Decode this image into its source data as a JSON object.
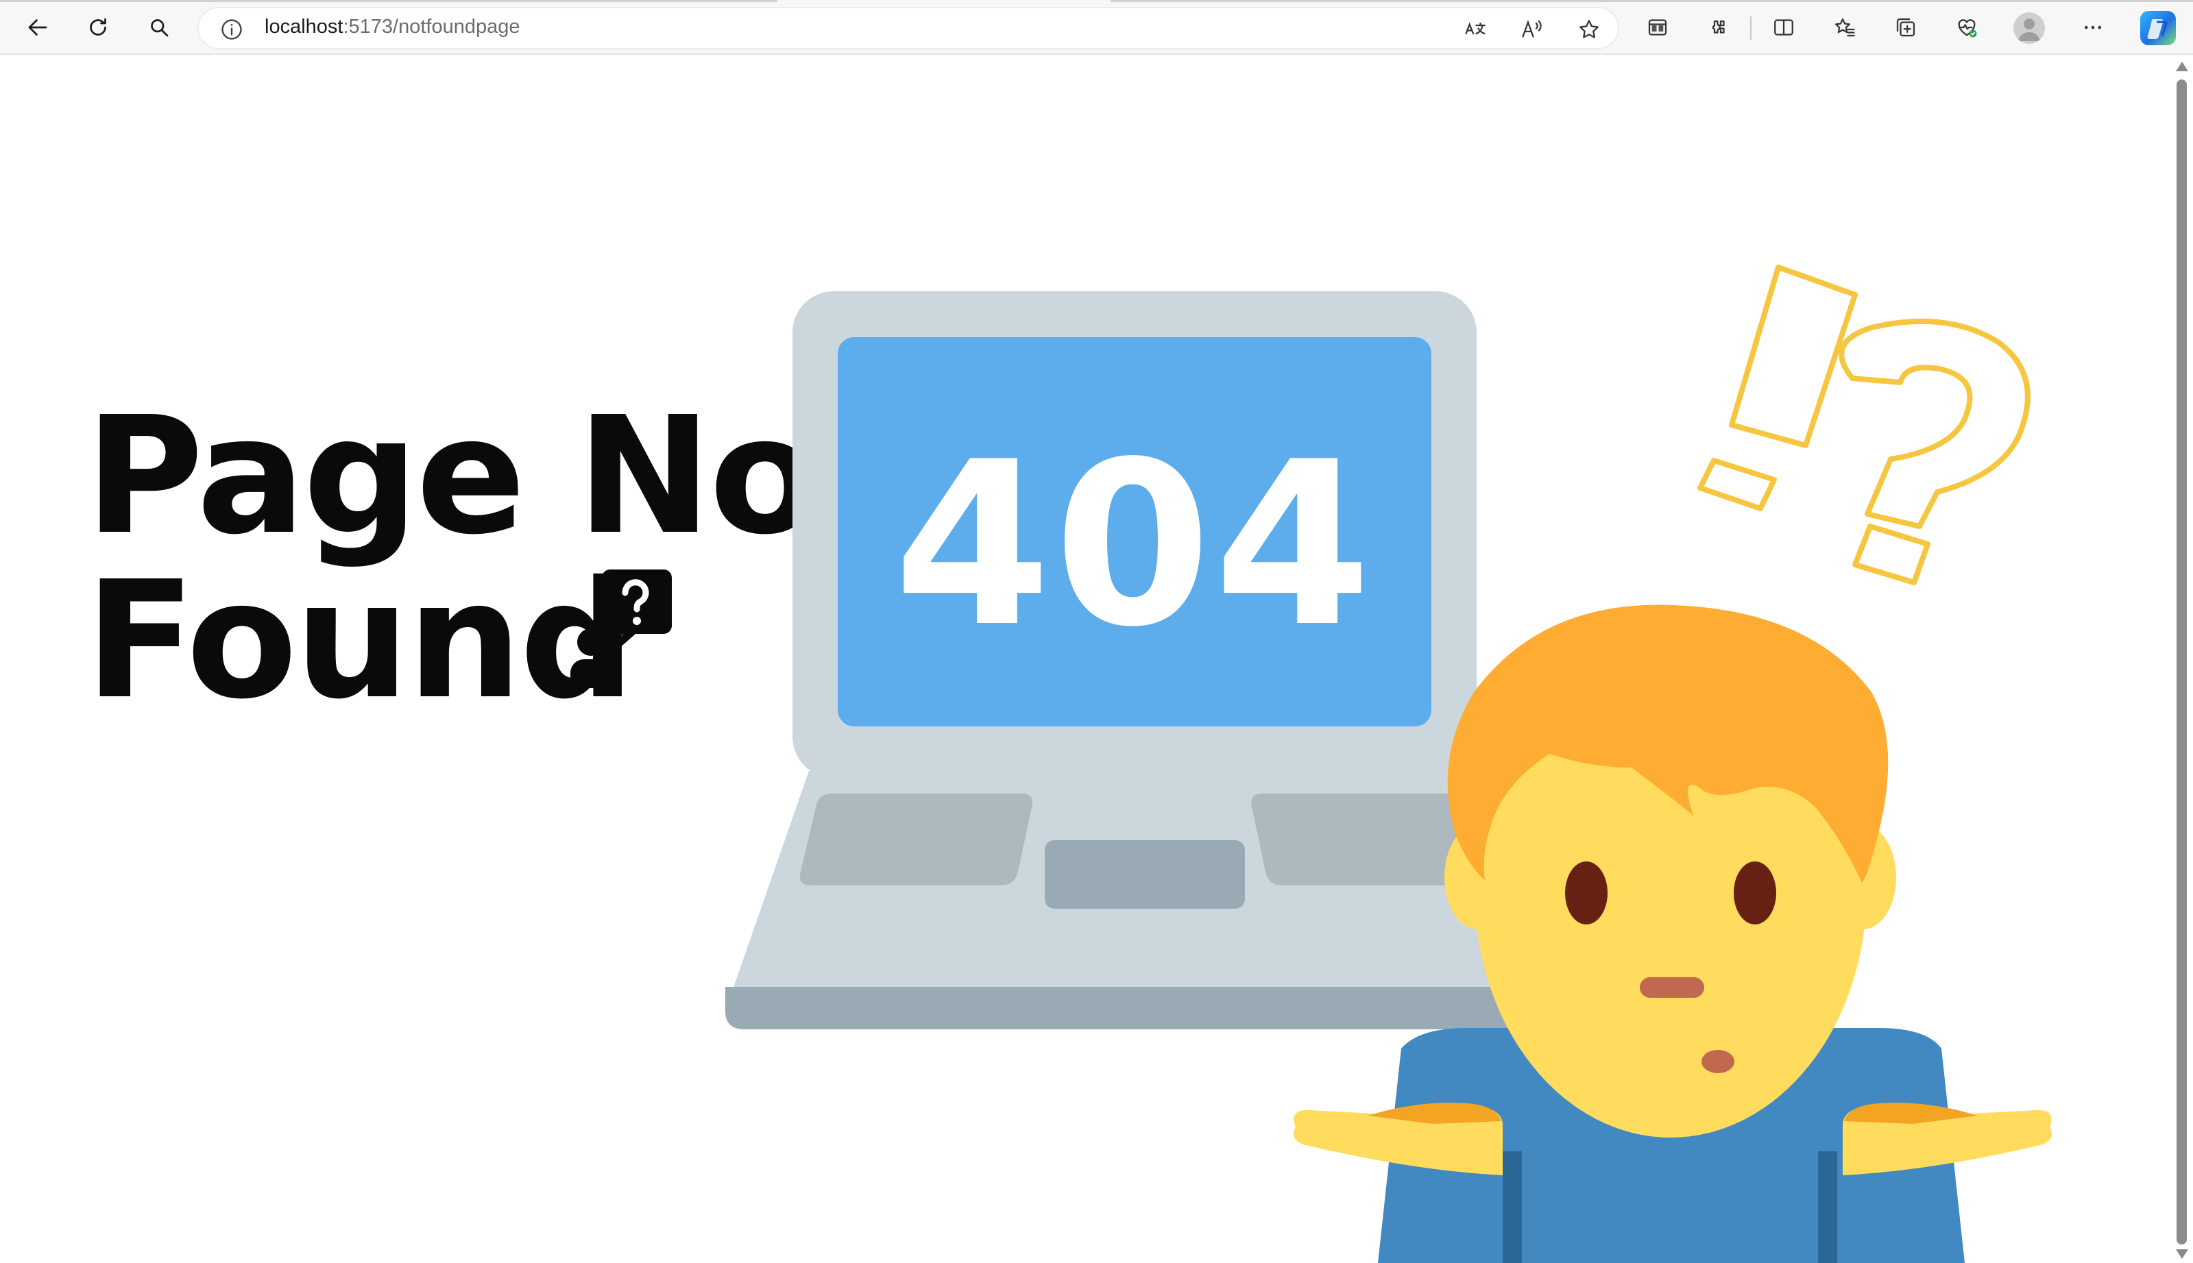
{
  "browser": {
    "url_host": "localhost",
    "url_path": ":5173/notfoundpage",
    "toolbar_icons": [
      "back-arrow-icon",
      "refresh-icon",
      "search-icon",
      "site-info-icon",
      "translate-icon",
      "read-aloud-icon",
      "favorite-star-icon",
      "workspaces-icon",
      "extensions-icon",
      "split-screen-icon",
      "favorites-icon",
      "collections-icon",
      "browser-essentials-icon",
      "profile-avatar-icon",
      "more-options-icon",
      "copilot-icon"
    ]
  },
  "page": {
    "heading_line1": "Page Not",
    "heading_line2": "Found",
    "screen_code": "404"
  },
  "colors": {
    "laptop_body": "#ccd6dd",
    "laptop_screen": "#5dadec",
    "hair": "#ffac33",
    "face": "#ffdc5d",
    "shirt": "#4289c1",
    "doodle": "#f7c640",
    "heading": "#0a0a0a"
  }
}
